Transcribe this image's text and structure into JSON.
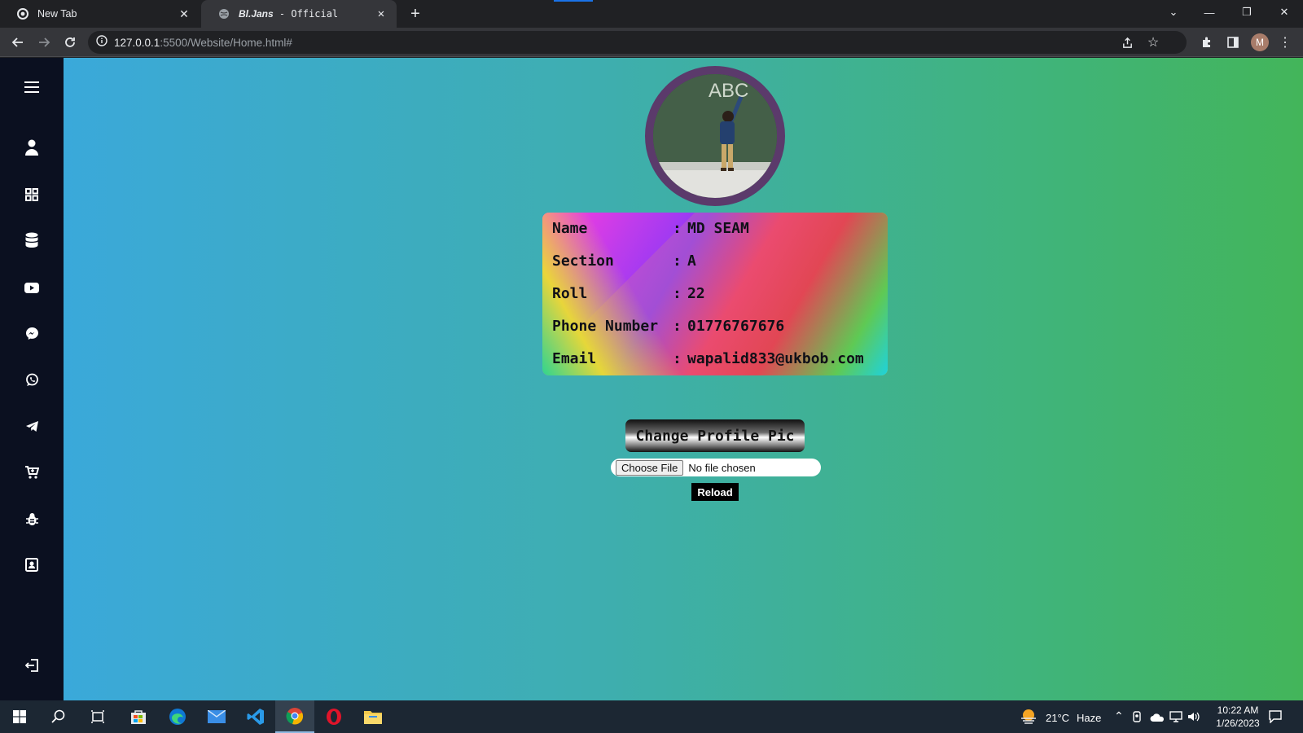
{
  "browser": {
    "tabs": [
      {
        "title": "New Tab",
        "active": false
      },
      {
        "title_bold": "Bl.Jans",
        "title_rest": " - Official",
        "active": true
      }
    ],
    "url_host": "127.0.0.1",
    "url_rest": ":5500/Website/Home.html#",
    "profile_initial": "M"
  },
  "sidebar": {
    "items": [
      "menu-icon",
      "user-icon",
      "dashboard-icon",
      "database-icon",
      "youtube-icon",
      "messenger-icon",
      "whatsapp-icon",
      "telegram-icon",
      "cart-icon",
      "bug-icon",
      "contact-icon",
      "logout-icon"
    ]
  },
  "profile": {
    "name_label": "Name",
    "name_value": "MD SEAM",
    "section_label": "Section",
    "section_value": "A",
    "roll_label": "Roll",
    "roll_value": "22",
    "phone_label": "Phone Number",
    "phone_value": "01776767676",
    "email_label": "Email",
    "email_value": "wapalid833@ukbob.com",
    "separator": ":",
    "board_text": "ABC"
  },
  "actions": {
    "change_pic": "Change Profile Pic",
    "choose_file": "Choose File",
    "no_file": "No file chosen",
    "reload": "Reload"
  },
  "taskbar": {
    "weather_temp": "21°C",
    "weather_cond": "Haze",
    "time": "10:22 AM",
    "date": "1/26/2023"
  },
  "colors": {
    "sidebar_bg": "#0b1020",
    "avatar_ring": "#5b3a6b",
    "gradient_left": "#3aa8df",
    "gradient_right": "#43b55a"
  }
}
